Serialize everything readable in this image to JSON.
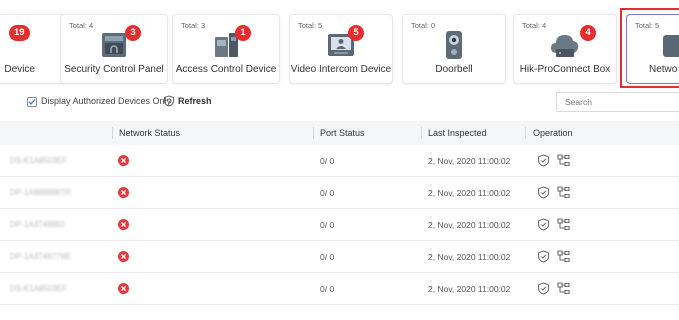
{
  "cards": [
    {
      "total": "",
      "name": "Device",
      "badge": "19"
    },
    {
      "total": "Total: 4",
      "name": "Security Control Panel",
      "badge": "3"
    },
    {
      "total": "Total: 3",
      "name": "Access Control Device",
      "badge": "1"
    },
    {
      "total": "Total: 5",
      "name": "Video Intercom Device",
      "badge": "5"
    },
    {
      "total": "Total: 0",
      "name": "Doorbell",
      "badge": ""
    },
    {
      "total": "Total: 4",
      "name": "Hik-ProConnect Box",
      "badge": "4"
    },
    {
      "total": "Total: 5",
      "name": "Netwo",
      "badge": ""
    }
  ],
  "toolbar": {
    "lead_text": "",
    "display_authorized_label": "Display Authorized Devices Only",
    "display_authorized_checked": true,
    "refresh_label": "Refresh",
    "search_placeholder": "Search"
  },
  "table": {
    "columns": [
      "Network Status",
      "Port Status",
      "Last Inspected",
      "Operation"
    ],
    "rows": [
      {
        "device": "DS-K1A8503EF",
        "network_status": "offline",
        "port_status": "0/ 0",
        "last_inspected": "2, Nov, 2020 11:00:02"
      },
      {
        "device": "DP-1A888888TR",
        "network_status": "offline",
        "port_status": "0/ 0",
        "last_inspected": "2, Nov, 2020 11:00:02"
      },
      {
        "device": "DP-1A3748893",
        "network_status": "offline",
        "port_status": "0/ 0",
        "last_inspected": "2, Nov, 2020 11:00:02"
      },
      {
        "device": "DP-1A3748779B",
        "network_status": "offline",
        "port_status": "0/ 0",
        "last_inspected": "2, Nov, 2020 11:00:02"
      },
      {
        "device": "DS-K1A8503EF",
        "network_status": "offline",
        "port_status": "0/ 0",
        "last_inspected": "2, Nov, 2020 11:00:02"
      }
    ]
  },
  "colors": {
    "badge": "#e52d2d",
    "offline": "#e23b3b",
    "selected_frame": "#e03030",
    "header_bg": "#f5f6f7"
  },
  "icons": {
    "card_icons": [
      "device-icon",
      "security-control-panel-icon",
      "access-control-icon",
      "video-intercom-icon",
      "doorbell-icon",
      "hik-proconnect-box-icon",
      "network-device-icon"
    ],
    "status": "offline-x-icon",
    "operations": [
      "shield-check-icon",
      "network-topology-icon"
    ]
  }
}
